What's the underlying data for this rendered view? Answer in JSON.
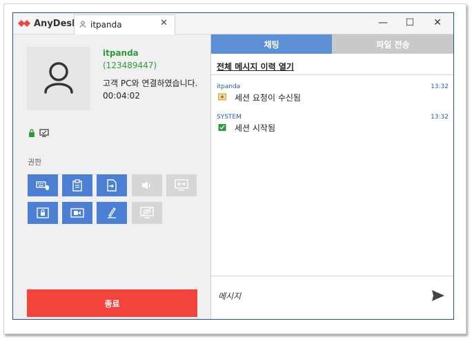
{
  "window": {
    "app_name": "AnyDesk",
    "tab_label": "itpanda",
    "tab_close": "✕",
    "minimize": "—",
    "maximize": "☐",
    "close": "✕"
  },
  "user": {
    "name": "itpanda",
    "id": "(123489447)",
    "status": "고객 PC와 연결하였습니다. 00:04:02"
  },
  "permissions": {
    "label": "권한",
    "buttons": [
      {
        "icon": "keyboard-mouse-icon",
        "enabled": true
      },
      {
        "icon": "clipboard-icon",
        "enabled": true
      },
      {
        "icon": "file-transfer-icon",
        "enabled": true
      },
      {
        "icon": "sound-icon",
        "enabled": false
      },
      {
        "icon": "switch-sides-icon",
        "enabled": false
      },
      {
        "icon": "lock-screen-icon",
        "enabled": true
      },
      {
        "icon": "record-icon",
        "enabled": true
      },
      {
        "icon": "draw-icon",
        "enabled": true
      },
      {
        "icon": "privacy-mode-icon",
        "enabled": false
      }
    ]
  },
  "end_button": "종료",
  "chat": {
    "tabs": [
      "채팅",
      "파일 전송"
    ],
    "history_link": "전체 메시지 이력 열기",
    "messages": [
      {
        "sender": "itpanda",
        "time": "13:32",
        "text": "세션 요청이 수신됨",
        "icon": "session-request-icon"
      },
      {
        "sender": "SYSTEM",
        "time": "13:32",
        "text": "세션 시작됨",
        "icon": "session-started-icon"
      }
    ],
    "input_placeholder": "메시지"
  },
  "colors": {
    "accent": "#4a7fd4",
    "active_tab": "#5b8fd6",
    "inactive_tab": "#c9c9c9",
    "end": "#f2443a",
    "user_green": "#2e9a3a"
  }
}
